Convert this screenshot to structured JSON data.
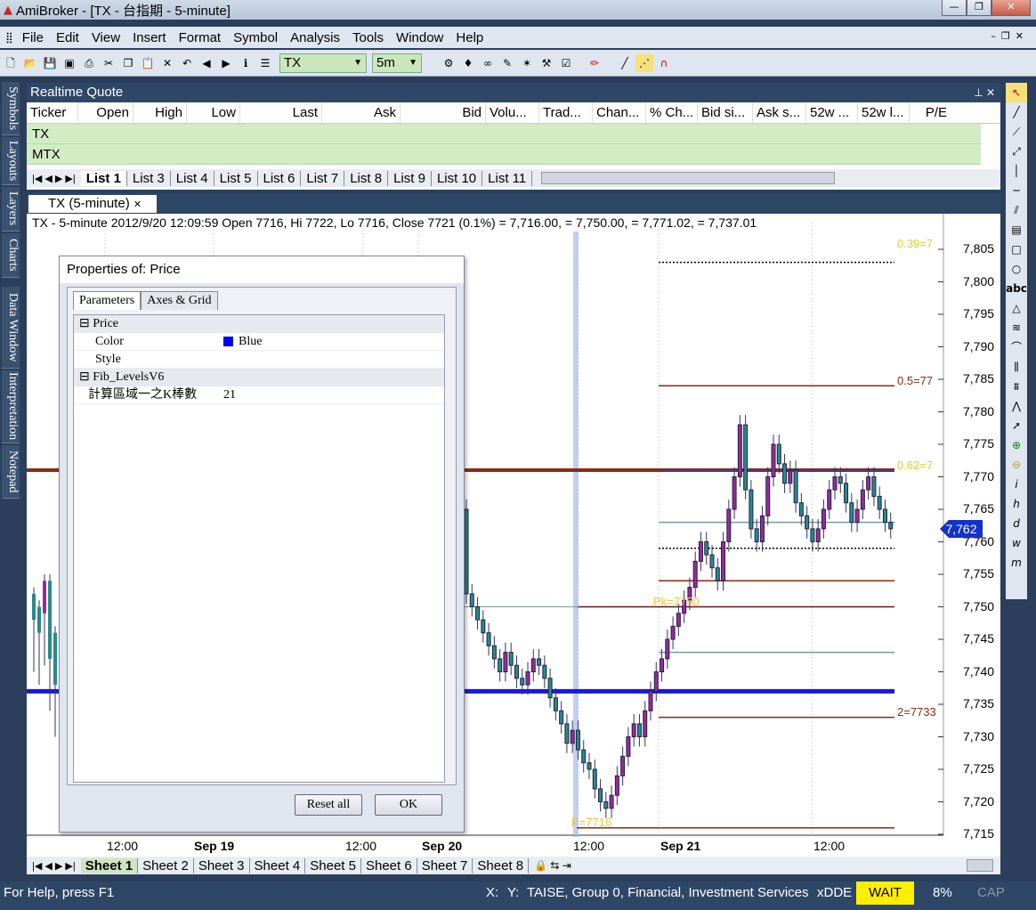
{
  "window": {
    "title": "AmiBroker - [TX - 台指期 - 5-minute]",
    "min": "—",
    "max": "❐",
    "close": "✕"
  },
  "menu": [
    "File",
    "Edit",
    "View",
    "Insert",
    "Format",
    "Symbol",
    "Analysis",
    "Tools",
    "Window",
    "Help"
  ],
  "toolbar": {
    "symbol": "TX",
    "interval": "5m"
  },
  "left_dock": [
    "Symbols",
    "Layouts",
    "Layers",
    "Charts",
    "Data Window",
    "Interpretation",
    "Notepad"
  ],
  "realtime_quote": {
    "title": "Realtime Quote",
    "columns": [
      "Ticker",
      "Open",
      "High",
      "Low",
      "Last",
      "Ask",
      "Bid",
      "Volu...",
      "Trad...",
      "Chan...",
      "% Ch...",
      "Bid si...",
      "Ask s...",
      "52w ...",
      "52w l...",
      "P/E"
    ],
    "rows": [
      "TX",
      "MTX"
    ],
    "list_tabs": [
      "List 1",
      "List 3",
      "List 4",
      "List 5",
      "List 6",
      "List 7",
      "List 8",
      "List 9",
      "List 10",
      "List 11"
    ]
  },
  "chart_tab": "TX (5-minute)",
  "chart_info": "TX - 5-minute 2012/9/20 12:09:59 Open 7716, Hi 7722, Lo 7716, Close 7721 (0.1%)   = 7,716.00,    = 7,750.00,    = 7,771.02,    = 7,737.01",
  "chart_data": {
    "type": "candlestick",
    "y_ticks": [
      "7,805",
      "7,800",
      "7,795",
      "7,790",
      "7,785",
      "7,780",
      "7,775",
      "7,770",
      "7,765",
      "7,760",
      "7,755",
      "7,750",
      "7,745",
      "7,740",
      "7,735",
      "7,730",
      "7,725",
      "7,720",
      "7,715"
    ],
    "ylim": [
      7714,
      7808
    ],
    "x_ticks": [
      "12:00",
      "Sep 19",
      "12:00",
      "Sep 20",
      "12:00",
      "Sep 21",
      "12:00"
    ],
    "last_price": "7,762",
    "fib_labels": [
      "0.39=7",
      "0.5=77",
      "0.62=7",
      "Pk=7750",
      "2=7733",
      "P=7716"
    ],
    "levels": [
      {
        "value": 7771.02,
        "color": "#8b2a10"
      },
      {
        "value": 7737.01,
        "color": "#1a1ad0"
      }
    ]
  },
  "dialog": {
    "title": "Properties of: Price",
    "tabs": [
      "Parameters",
      "Axes & Grid"
    ],
    "sections": [
      {
        "name": "Price",
        "items": [
          {
            "key": "Color",
            "value": "Blue"
          },
          {
            "key": "Style",
            "value": ""
          }
        ]
      },
      {
        "name": "Fib_LevelsV6",
        "items": [
          {
            "key": "計算區域一之K棒數",
            "value": "21"
          }
        ]
      }
    ],
    "reset_label": "Reset all",
    "ok_label": "OK"
  },
  "sheet_tabs": [
    "Sheet 1",
    "Sheet 2",
    "Sheet 3",
    "Sheet 4",
    "Sheet 5",
    "Sheet 6",
    "Sheet 7",
    "Sheet 8"
  ],
  "status": {
    "help": "For Help, press F1",
    "x": "X:",
    "y": "Y:",
    "info": "TAISE, Group 0, Financial, Investment Services",
    "dde": "xDDE",
    "wait": "WAIT",
    "pct": "8%",
    "cap": "CAP"
  }
}
